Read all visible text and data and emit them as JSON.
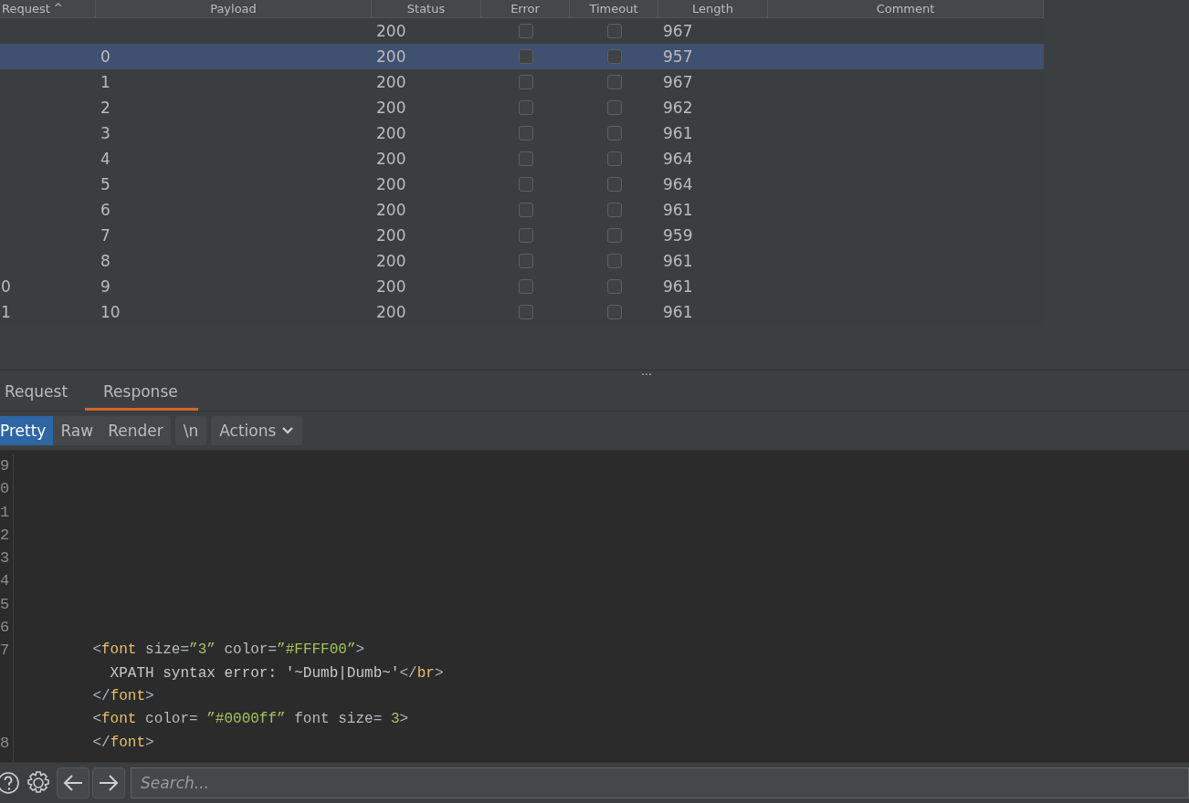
{
  "table": {
    "columns": [
      "Request",
      "Payload",
      "Status",
      "Error",
      "Timeout",
      "Length",
      "Comment"
    ],
    "sort_indicator": "^",
    "rows": [
      {
        "status": "200",
        "error": false,
        "timeout": false,
        "length": "967",
        "selected": false
      },
      {
        "payload": "0",
        "status": "200",
        "error": false,
        "timeout": false,
        "length": "957",
        "selected": true
      },
      {
        "payload": "1",
        "status": "200",
        "error": false,
        "timeout": false,
        "length": "967",
        "selected": false
      },
      {
        "payload": "2",
        "status": "200",
        "error": false,
        "timeout": false,
        "length": "962",
        "selected": false
      },
      {
        "payload": "3",
        "status": "200",
        "error": false,
        "timeout": false,
        "length": "961",
        "selected": false
      },
      {
        "payload": "4",
        "status": "200",
        "error": false,
        "timeout": false,
        "length": "964",
        "selected": false
      },
      {
        "payload": "5",
        "status": "200",
        "error": false,
        "timeout": false,
        "length": "964",
        "selected": false
      },
      {
        "payload": "6",
        "status": "200",
        "error": false,
        "timeout": false,
        "length": "961",
        "selected": false
      },
      {
        "payload": "7",
        "status": "200",
        "error": false,
        "timeout": false,
        "length": "959",
        "selected": false
      },
      {
        "payload": "8",
        "status": "200",
        "error": false,
        "timeout": false,
        "length": "961",
        "selected": false
      },
      {
        "request": "0",
        "payload": "9",
        "status": "200",
        "error": false,
        "timeout": false,
        "length": "961",
        "selected": false
      },
      {
        "request": "1",
        "payload": "10",
        "status": "200",
        "error": false,
        "timeout": false,
        "length": "961",
        "selected": false
      }
    ]
  },
  "splitter": "...",
  "tabs": [
    {
      "label": "Request",
      "selected": false
    },
    {
      "label": "Response",
      "selected": true
    }
  ],
  "view_buttons": [
    {
      "label": "Pretty",
      "selected": true
    },
    {
      "label": "Raw",
      "selected": false
    },
    {
      "label": "Render",
      "selected": false
    }
  ],
  "newline_button": "\\n",
  "actions_button": "Actions",
  "code_lines": [
    {
      "number": "9"
    },
    {
      "number": "0"
    },
    {
      "number": "1"
    },
    {
      "number": "2"
    },
    {
      "number": "3"
    },
    {
      "number": "4"
    },
    {
      "number": "5"
    },
    {
      "number": "6"
    },
    {
      "number": "7",
      "tokens": [
        {
          "kind": "punct",
          "text": "         <"
        },
        {
          "kind": "tag",
          "text": "font"
        },
        {
          "kind": "attr",
          "text": " size"
        },
        {
          "kind": "punct",
          "text": "="
        },
        {
          "kind": "value",
          "text": "”3”"
        },
        {
          "kind": "attr",
          "text": " color"
        },
        {
          "kind": "punct",
          "text": "="
        },
        {
          "kind": "value",
          "text": "”#FFFF00”"
        },
        {
          "kind": "punct",
          "text": ">"
        }
      ]
    },
    {
      "tokens": [
        {
          "kind": "text",
          "text": "           XPATH syntax error: '~Dumb|Dumb~'"
        },
        {
          "kind": "punct",
          "text": "</"
        },
        {
          "kind": "tag",
          "text": "br"
        },
        {
          "kind": "punct",
          "text": ">"
        }
      ]
    },
    {
      "tokens": [
        {
          "kind": "punct",
          "text": "         </"
        },
        {
          "kind": "tag",
          "text": "font"
        },
        {
          "kind": "punct",
          "text": ">"
        }
      ]
    },
    {
      "tokens": [
        {
          "kind": "punct",
          "text": "         <"
        },
        {
          "kind": "tag",
          "text": "font"
        },
        {
          "kind": "attr",
          "text": " color"
        },
        {
          "kind": "punct",
          "text": "= "
        },
        {
          "kind": "value",
          "text": "”#0000ff”"
        },
        {
          "kind": "attr",
          "text": " font size"
        },
        {
          "kind": "punct",
          "text": "= "
        },
        {
          "kind": "value",
          "text": "3"
        },
        {
          "kind": "punct",
          "text": ">"
        }
      ]
    },
    {
      "number": "8",
      "tokens": [
        {
          "kind": "punct",
          "text": "         </"
        },
        {
          "kind": "tag",
          "text": "font"
        },
        {
          "kind": "punct",
          "text": ">"
        }
      ]
    }
  ],
  "search": {
    "placeholder": "Search..."
  }
}
